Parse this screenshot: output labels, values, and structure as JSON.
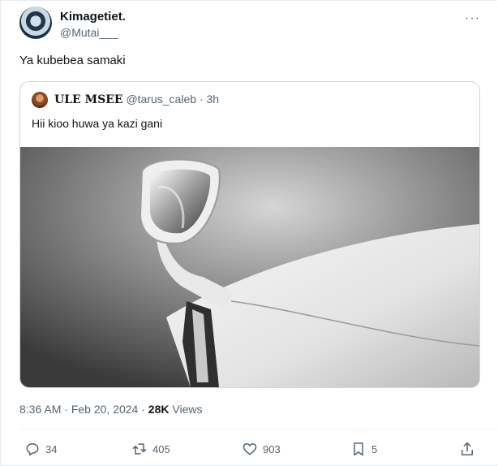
{
  "author": {
    "name": "Kimagetiet.",
    "handle": "@Mutai___"
  },
  "tweet": {
    "text": "Ya kubebea samaki"
  },
  "quoted": {
    "name": "ULE MSEE",
    "handle": "@tarus_caleb",
    "separator": "·",
    "time": "3h",
    "text": "Hii kioo huwa ya kazi gani"
  },
  "meta": {
    "time": "8:36 AM",
    "separator": "·",
    "date": "Feb 20, 2024",
    "separator2": "·",
    "views_count": "28K",
    "views_label": "Views"
  },
  "actions": {
    "replies": "34",
    "retweets": "405",
    "likes": "903",
    "bookmarks": "5"
  },
  "more_label": "···",
  "colors": {
    "text": "#0f1419",
    "muted": "#536471",
    "border": "#cfd9de"
  },
  "icons": [
    "more-icon",
    "reply-icon",
    "retweet-icon",
    "like-icon",
    "bookmark-icon",
    "share-icon"
  ]
}
